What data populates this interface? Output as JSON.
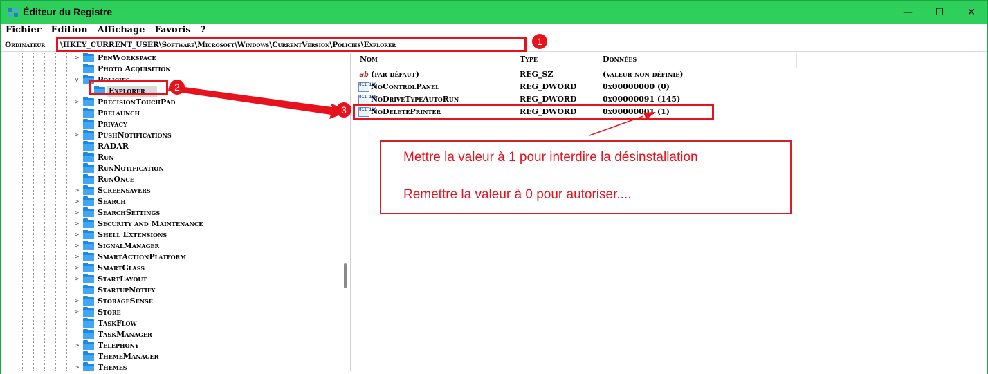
{
  "window": {
    "title": "Éditeur du Registre",
    "controls": {
      "minimize": "—",
      "maximize": "☐",
      "close": "✕"
    }
  },
  "menu": [
    "Fichier",
    "Edition",
    "Affichage",
    "Favoris",
    "?"
  ],
  "address": {
    "root": "Ordinateur",
    "path": "\\HKEY_CURRENT_USER\\Software\\Microsoft\\Windows\\CurrentVersion\\Policies\\Explorer"
  },
  "tree": {
    "items": [
      {
        "label": "PenWorkspace",
        "expand": ">"
      },
      {
        "label": "Photo Acquisition",
        "expand": ""
      },
      {
        "label": "Policies",
        "expand": "v"
      },
      {
        "label": "Explorer",
        "expand": "",
        "selected": true
      },
      {
        "label": "PrecisionTouchPad",
        "expand": ">"
      },
      {
        "label": "Prelaunch",
        "expand": ""
      },
      {
        "label": "Privacy",
        "expand": ""
      },
      {
        "label": "PushNotifications",
        "expand": ">"
      },
      {
        "label": "RADAR",
        "expand": ""
      },
      {
        "label": "Run",
        "expand": ""
      },
      {
        "label": "RunNotification",
        "expand": ""
      },
      {
        "label": "RunOnce",
        "expand": ""
      },
      {
        "label": "Screensavers",
        "expand": ">"
      },
      {
        "label": "Search",
        "expand": ">"
      },
      {
        "label": "SearchSettings",
        "expand": ">"
      },
      {
        "label": "Security and Maintenance",
        "expand": ">"
      },
      {
        "label": "Shell Extensions",
        "expand": ">"
      },
      {
        "label": "SignalManager",
        "expand": ">"
      },
      {
        "label": "SmartActionPlatform",
        "expand": ">"
      },
      {
        "label": "SmartGlass",
        "expand": ">"
      },
      {
        "label": "StartLayout",
        "expand": ">"
      },
      {
        "label": "StartupNotify",
        "expand": ""
      },
      {
        "label": "StorageSense",
        "expand": ">"
      },
      {
        "label": "Store",
        "expand": ">"
      },
      {
        "label": "TaskFlow",
        "expand": ""
      },
      {
        "label": "TaskManager",
        "expand": ""
      },
      {
        "label": "Telephony",
        "expand": ">"
      },
      {
        "label": "ThemeManager",
        "expand": ""
      },
      {
        "label": "Themes",
        "expand": ">"
      }
    ]
  },
  "list": {
    "columns": {
      "name": "Nom",
      "type": "Type",
      "data": "Données"
    },
    "rows": [
      {
        "icon": "ab",
        "name": "(par défaut)",
        "type": "REG_SZ",
        "data": "(valeur non définie)"
      },
      {
        "icon": "011 110",
        "name": "NoControlPanel",
        "type": "REG_DWORD",
        "data": "0x00000000 (0)"
      },
      {
        "icon": "011 110",
        "name": "NoDriveTypeAutoRun",
        "type": "REG_DWORD",
        "data": "0x00000091 (145)"
      },
      {
        "icon": "011 110",
        "name": "NoDeletePrinter",
        "type": "REG_DWORD",
        "data": "0x00000001 (1)"
      }
    ]
  },
  "annotations": {
    "badges": [
      "1",
      "2",
      "3"
    ],
    "callout_lines": [
      "Mettre la valeur à 1 pour interdire la désinstallation",
      "Remettre la valeur à 0 pour autoriser...."
    ],
    "color": "#e8121c"
  }
}
